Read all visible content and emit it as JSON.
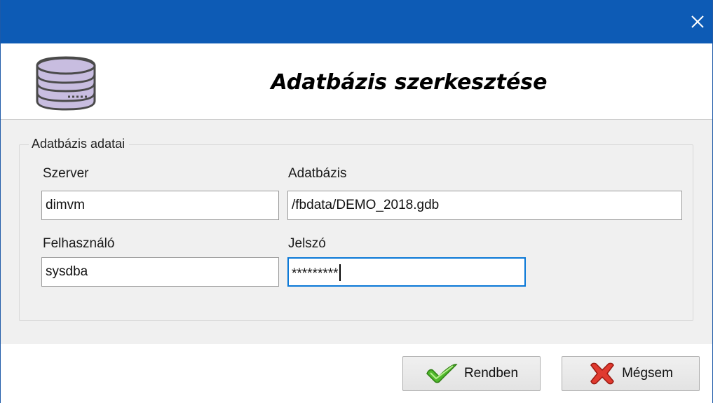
{
  "window": {
    "close_icon": "close-icon"
  },
  "header": {
    "icon": "database-icon",
    "title": "Adatbázis szerkesztése"
  },
  "group": {
    "legend": "Adatbázis adatai",
    "fields": {
      "server": {
        "label": "Szerver",
        "value": "dimvm"
      },
      "database": {
        "label": "Adatbázis",
        "value": "/fbdata/DEMO_2018.gdb"
      },
      "user": {
        "label": "Felhasználó",
        "value": "sysdba"
      },
      "password": {
        "label": "Jelszó",
        "value": "*********"
      }
    }
  },
  "buttons": {
    "ok": {
      "label": "Rendben",
      "icon": "checkmark-icon"
    },
    "cancel": {
      "label": "Mégsem",
      "icon": "cross-icon"
    }
  },
  "colors": {
    "titlebar": "#0d5bb5",
    "focus": "#0a78d7",
    "database_icon": "#c8bde0"
  }
}
